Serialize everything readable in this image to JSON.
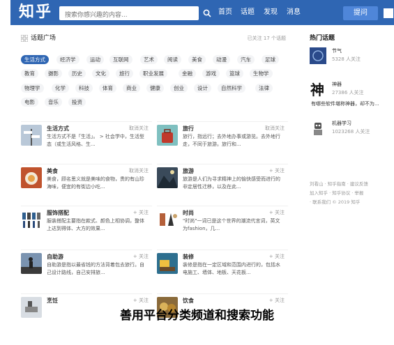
{
  "header": {
    "logo": "知乎",
    "search_placeholder": "搜索你感兴趣的内容...",
    "nav": [
      "首页",
      "话题",
      "发现",
      "消息"
    ],
    "ask_button": "提问"
  },
  "main": {
    "title": "话题广场",
    "follow_count": "已关注 17 个话题",
    "chips": [
      [
        "生活方式",
        "经济学",
        "运动",
        "互联网",
        "艺术",
        "阅读",
        "美食",
        "动漫",
        "汽车",
        "足球"
      ],
      [
        "教育",
        "摄影",
        "历史",
        "文化",
        "旅行",
        "职业发展",
        "金融",
        "游戏",
        "篮球",
        "生物学"
      ],
      [
        "物理学",
        "化学",
        "科技",
        "体育",
        "商业",
        "健康",
        "创业",
        "设计",
        "自然科学",
        "法律"
      ],
      [
        "电影",
        "音乐",
        "投资"
      ]
    ],
    "topics": [
      {
        "name": "生活方式",
        "follow": "取消关注",
        "desc": "生活方式不是「生活」。 > 社会学中，生活型态（或生活风格、生..."
      },
      {
        "name": "旅行",
        "follow": "取消关注",
        "desc": "旅行，指远行；去外地办事或游览。去外地行走，不同于旅游。旅行和..."
      },
      {
        "name": "美食",
        "follow": "取消关注",
        "desc": "美食，顾名思义就是美味的食物，贵的有山珍海味，便宜的有街边小吃..."
      },
      {
        "name": "旅游",
        "follow": "+ 关注",
        "desc": "旅游是人们为寻求精神上的愉快感受而进行的非定居性迁移，以及在此..."
      },
      {
        "name": "服饰搭配",
        "follow": "+ 关注",
        "desc": "服装搭配主要指在款式、颜色上相协调，整体上达到得体、大方的效果..."
      },
      {
        "name": "时尚",
        "follow": "+ 关注",
        "desc": "\"时尚\"一词已是这个世界的潮流代言词，英文为fashion，几..."
      },
      {
        "name": "自助游",
        "follow": "+ 关注",
        "desc": "自助游是指以最省钱的方法背着包去旅行。自己设计路线，自己安排旅..."
      },
      {
        "name": "装修",
        "follow": "+ 关注",
        "desc": "装修是指在一定区域和范围内进行的，包括水电施工、墙体、地板、天花板..."
      },
      {
        "name": "烹饪",
        "follow": "+ 关注",
        "desc": ""
      },
      {
        "name": "饮食",
        "follow": "+ 关注",
        "desc": ""
      }
    ]
  },
  "sidebar": {
    "title": "热门话题",
    "items": [
      {
        "name": "节气",
        "meta": "5328 人关注"
      },
      {
        "name": "神器",
        "meta": "27386 人关注",
        "extra": "有哪些软件堪称神器，却不为..."
      },
      {
        "name": "机器学习",
        "meta": "1023268 人关注"
      }
    ],
    "footer": [
      "刘看山 · 知乎指南 · 建议反馈",
      "加入知乎 · 知乎协议 · 举报",
      "· 联系我们 © 2019 知乎"
    ]
  },
  "caption": "善用平台分类频道和搜索功能",
  "colors": {
    "brand": "#2f66b3",
    "ask": "#4f86d9"
  }
}
